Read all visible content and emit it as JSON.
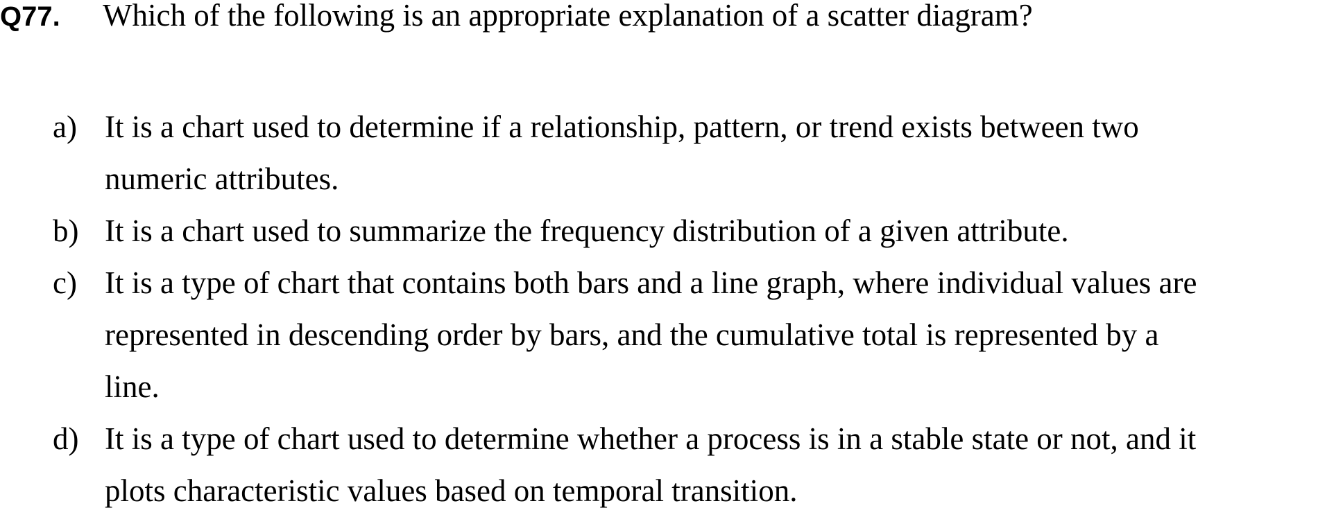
{
  "question": {
    "number": "Q77.",
    "text": "Which of the following is an appropriate explanation of a scatter diagram?"
  },
  "options": [
    {
      "letter": "a)",
      "lines": [
        "It is a chart used to determine if a relationship, pattern, or trend exists between two",
        "numeric attributes."
      ]
    },
    {
      "letter": "b)",
      "lines": [
        "It is a chart used to summarize the frequency distribution of a given attribute."
      ]
    },
    {
      "letter": "c)",
      "lines": [
        "It is a type of chart that contains both bars and a line graph, where individual values are",
        "represented in descending order by bars, and the cumulative total is represented by a",
        "line."
      ]
    },
    {
      "letter": "d)",
      "lines": [
        "It is a type of chart used to determine whether a process is in a stable state or not, and it",
        "plots characteristic values based on temporal transition."
      ]
    }
  ]
}
